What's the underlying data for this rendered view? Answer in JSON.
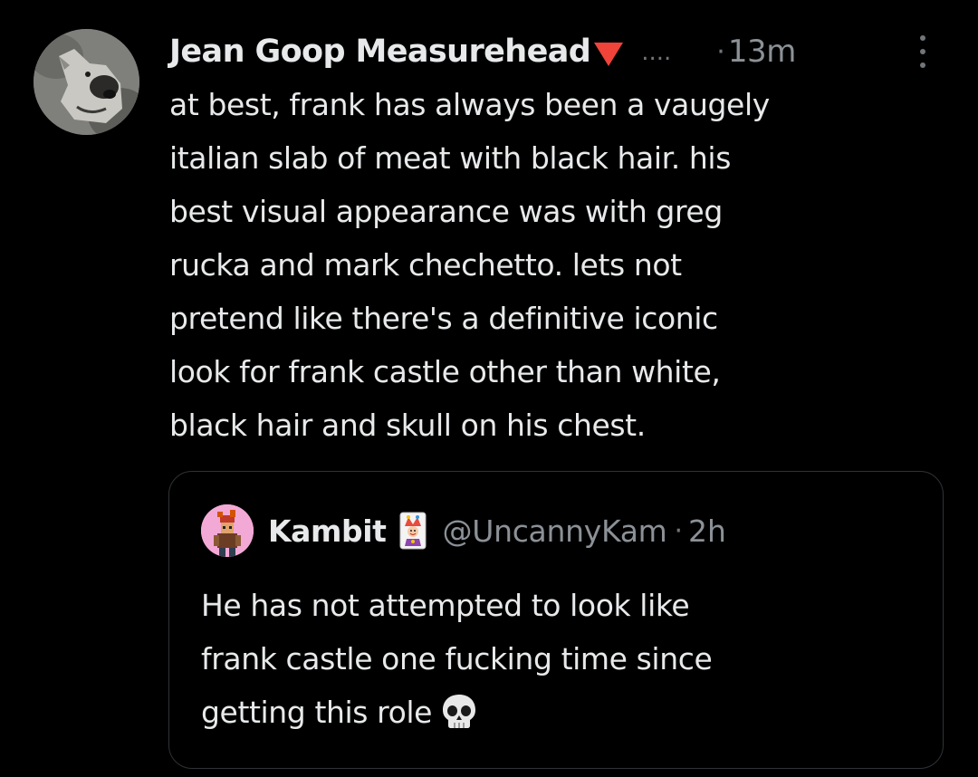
{
  "post": {
    "author_name": "Jean Goop Measurehead",
    "author_flag_icon": "red-triangle-down-icon",
    "name_truncation": "....",
    "separator": "·",
    "time": "13m",
    "more_icon": "vertical-dots-icon",
    "text": "at best, frank has always  been a vaugely\nitalian slab of meat with black hair. his\nbest visual appearance was with greg\nrucka and mark chechetto. lets not\npretend like there's a definitive iconic\nlook for frank castle other than white,\nblack hair and skull on his chest."
  },
  "quoted_post": {
    "author_name": "Kambit",
    "author_badge_icon": "joker-card-icon",
    "handle": "@UncannyKam",
    "separator": "·",
    "time": "2h",
    "text": "He has not attempted to look like\nfrank castle one fucking time since\ngetting this role",
    "emoji_icon": "skull-icon"
  },
  "colors": {
    "background": "#000000",
    "text_primary": "#e7e9ea",
    "text_secondary": "#8b9196",
    "border": "#2f3336",
    "flag": "#f0433a",
    "quote_avatar_bg": "#f3a9d6"
  }
}
